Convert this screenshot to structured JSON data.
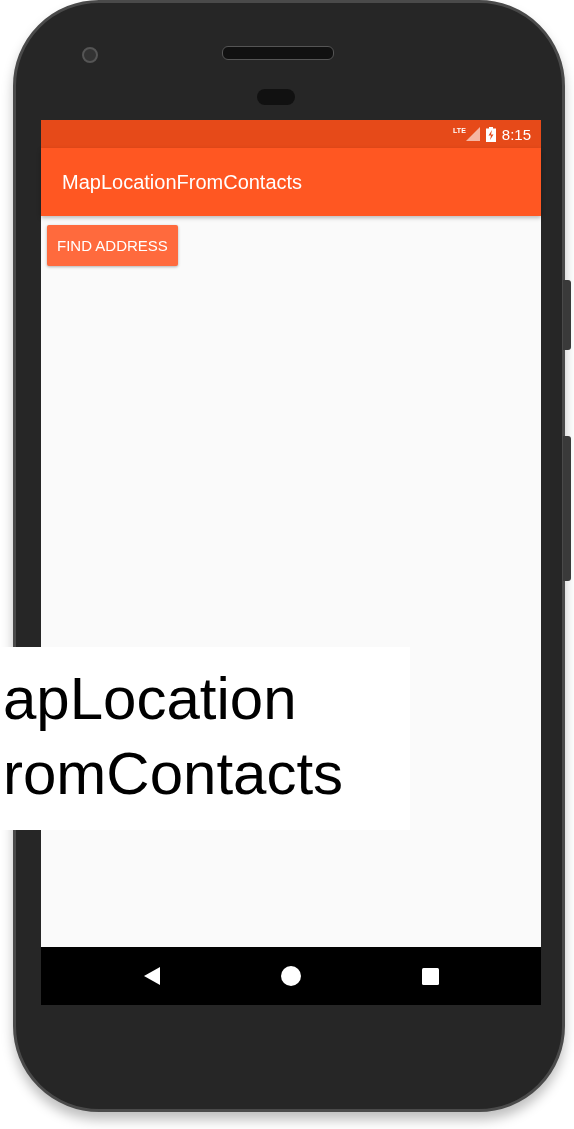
{
  "status_bar": {
    "network": "LTE",
    "time": "8:15"
  },
  "app_bar": {
    "title": "MapLocationFromContacts"
  },
  "button": {
    "label": "FIND ADDRESS"
  },
  "caption": {
    "lines": [
      "apLocation",
      "romContacts"
    ]
  }
}
